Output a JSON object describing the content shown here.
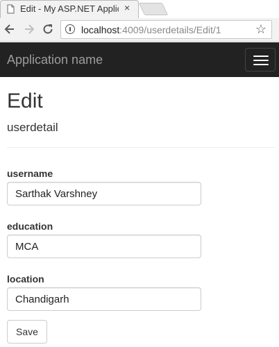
{
  "browser": {
    "tab_title": "Edit - My ASP.NET Applic",
    "close_glyph": "×",
    "url_host": "localhost",
    "url_rest": ":4009/userdetails/Edit/1"
  },
  "navbar": {
    "brand": "Application name"
  },
  "page": {
    "title": "Edit",
    "subtitle": "userdetail"
  },
  "form": {
    "username": {
      "label": "username",
      "value": "Sarthak Varshney"
    },
    "education": {
      "label": "education",
      "value": "MCA"
    },
    "location": {
      "label": "location",
      "value": "Chandigarh"
    },
    "save_label": "Save"
  },
  "colors": {
    "navbar_bg": "#222222",
    "brand_text": "#9d9d9d"
  }
}
